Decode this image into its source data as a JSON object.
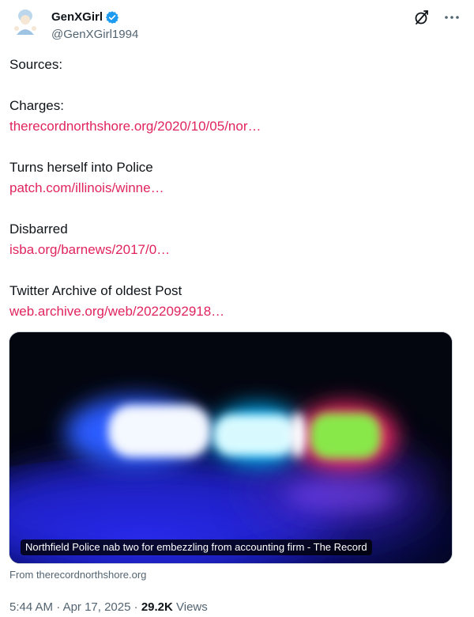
{
  "header": {
    "display_name": "GenXGirl",
    "handle": "@GenXGirl1994",
    "verified_color": "#1d9bf0"
  },
  "tweet": {
    "lines": {
      "sources": "Sources:",
      "charges_label": "Charges:",
      "charges_link": "therecordnorthshore.org/2020/10/05/nor…",
      "police_label": "Turns herself into Police",
      "police_link": "patch.com/illinois/winne…",
      "disbarred_label": "Disbarred",
      "disbarred_link": "isba.org/barnews/2017/0…",
      "archive_label": "Twitter Archive of oldest Post",
      "archive_link": "web.archive.org/web/2022092918…"
    },
    "link_color": "#e0245e"
  },
  "card": {
    "caption": "Northfield Police nab two for embezzling from accounting firm - The Record",
    "source": "From therecordnorthshore.org"
  },
  "meta": {
    "time": "5:44 AM",
    "sep1": "·",
    "date": "Apr 17, 2025",
    "sep2": "·",
    "views_count": "29.2K",
    "views_label": "Views"
  },
  "icons": [
    "avatar",
    "verified-badge-icon",
    "grok-icon",
    "more-options-icon"
  ]
}
